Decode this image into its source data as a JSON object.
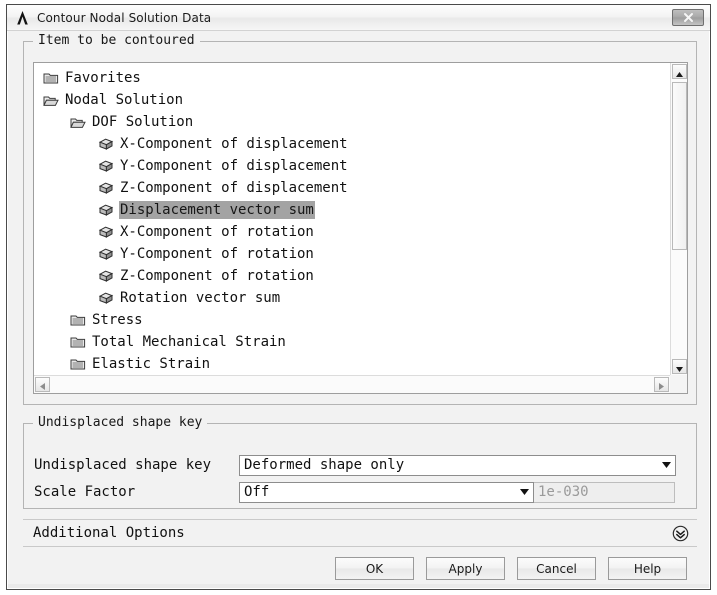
{
  "window": {
    "title": "Contour Nodal Solution Data",
    "logo_icon": "ansys-a-logo",
    "close_icon": "close-x-icon"
  },
  "contour_group": {
    "label": "Item to be contoured",
    "tree_items": [
      {
        "label": "Favorites",
        "level": 0,
        "icon": "closed-folder-icon",
        "selected": false
      },
      {
        "label": "Nodal Solution",
        "level": 0,
        "icon": "open-folder-icon",
        "selected": false
      },
      {
        "label": "DOF Solution",
        "level": 1,
        "icon": "open-folder-icon",
        "selected": false
      },
      {
        "label": "X-Component of displacement",
        "level": 2,
        "icon": "cube-icon",
        "selected": false
      },
      {
        "label": "Y-Component of displacement",
        "level": 2,
        "icon": "cube-icon",
        "selected": false
      },
      {
        "label": "Z-Component of displacement",
        "level": 2,
        "icon": "cube-icon",
        "selected": false
      },
      {
        "label": "Displacement vector sum",
        "level": 2,
        "icon": "cube-icon",
        "selected": true
      },
      {
        "label": "X-Component of rotation",
        "level": 2,
        "icon": "cube-icon",
        "selected": false
      },
      {
        "label": "Y-Component of rotation",
        "level": 2,
        "icon": "cube-icon",
        "selected": false
      },
      {
        "label": "Z-Component of rotation",
        "level": 2,
        "icon": "cube-icon",
        "selected": false
      },
      {
        "label": "Rotation vector sum",
        "level": 2,
        "icon": "cube-icon",
        "selected": false
      },
      {
        "label": "Stress",
        "level": 1,
        "icon": "closed-folder-icon",
        "selected": false
      },
      {
        "label": "Total Mechanical Strain",
        "level": 1,
        "icon": "closed-folder-icon",
        "selected": false
      },
      {
        "label": "Elastic Strain",
        "level": 1,
        "icon": "closed-folder-icon",
        "selected": false
      }
    ],
    "scrollbars": {
      "vertical_up_icon": "scroll-up-arrow-icon",
      "vertical_down_icon": "scroll-down-arrow-icon",
      "horizontal_left_icon": "scroll-left-arrow-icon",
      "horizontal_right_icon": "scroll-right-arrow-icon"
    }
  },
  "undisplaced_group": {
    "label": "Undisplaced shape key",
    "shape_key": {
      "label": "Undisplaced shape key",
      "value": "Deformed shape only",
      "arrow_icon": "dropdown-arrow-icon"
    },
    "scale_factor": {
      "label": "Scale Factor",
      "value": "Off",
      "arrow_icon": "dropdown-arrow-icon",
      "custom_value": "1e-030"
    }
  },
  "additional_options": {
    "label": "Additional Options",
    "expander_icon": "double-chevron-down-icon"
  },
  "buttons": [
    {
      "label": "OK"
    },
    {
      "label": "Apply"
    },
    {
      "label": "Cancel"
    },
    {
      "label": "Help"
    }
  ],
  "colors": {
    "dialog_bg": "#f2f2f2",
    "tree_bg": "#ffffff",
    "selection_bg": "#a3a3a3",
    "text": "#111111",
    "disabled_text": "#9a9a9a",
    "border": "#b4b4b4"
  }
}
